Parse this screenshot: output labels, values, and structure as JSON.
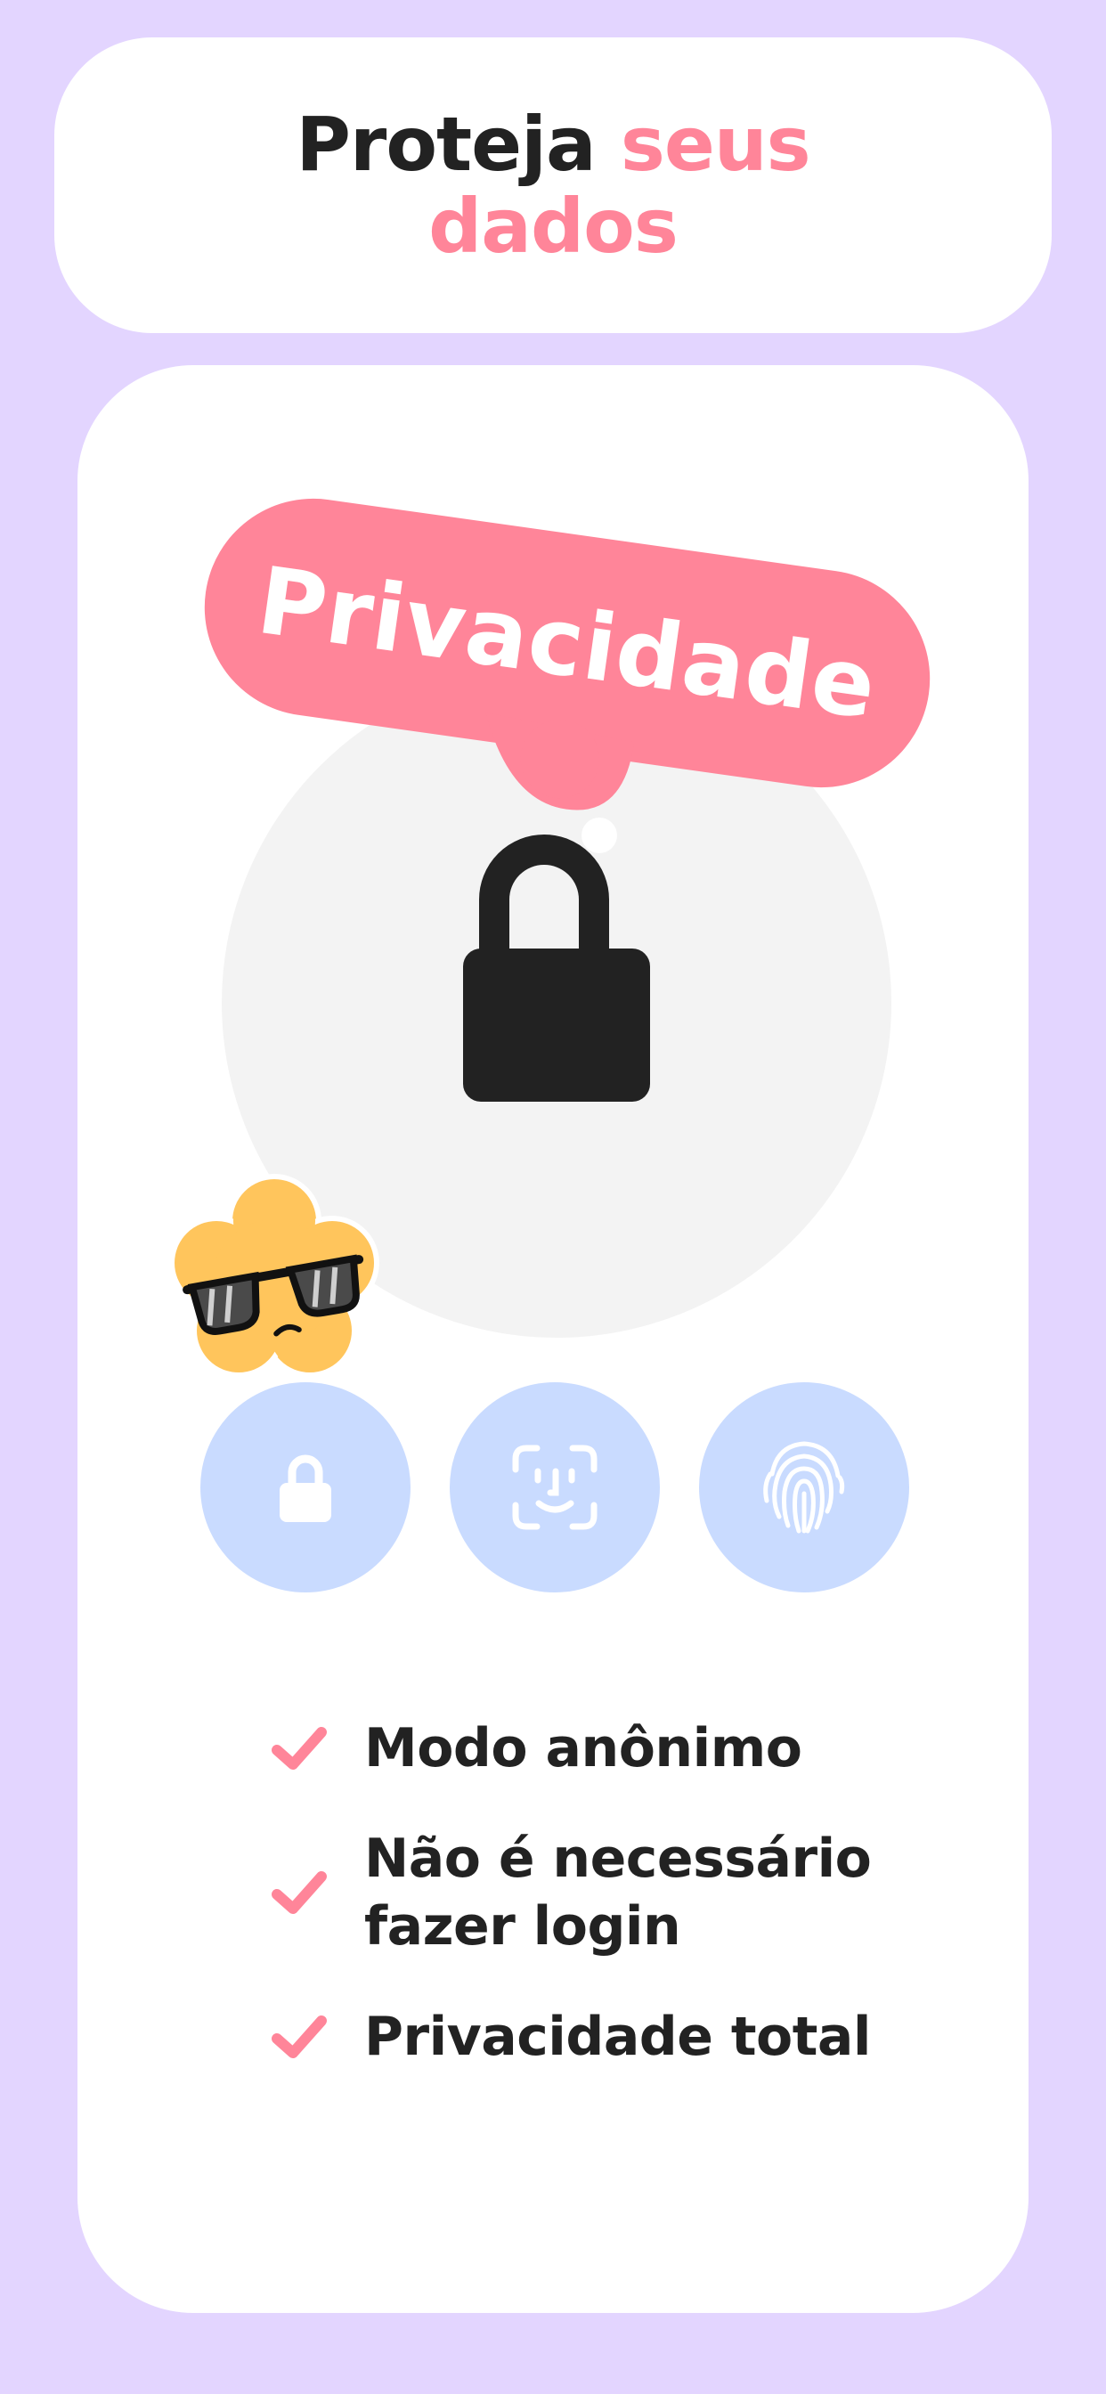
{
  "header": {
    "title_part1": "Proteja",
    "title_part2": "seus",
    "title_part3": "dados"
  },
  "hero": {
    "tag_label": "Privacidade"
  },
  "auth_options": [
    {
      "icon": "lock-icon"
    },
    {
      "icon": "face-id-icon"
    },
    {
      "icon": "fingerprint-icon"
    }
  ],
  "features": [
    {
      "line1": "Modo anônimo",
      "line2": ""
    },
    {
      "line1": "Não é necessário",
      "line2": "fazer login"
    },
    {
      "line1": "Privacidade total",
      "line2": ""
    }
  ],
  "colors": {
    "background": "#E3D5FF",
    "accent_pink": "#FF8599",
    "text_dark": "#222222",
    "button_blue": "#C9DBFF",
    "flower_yellow": "#FFC55C"
  }
}
